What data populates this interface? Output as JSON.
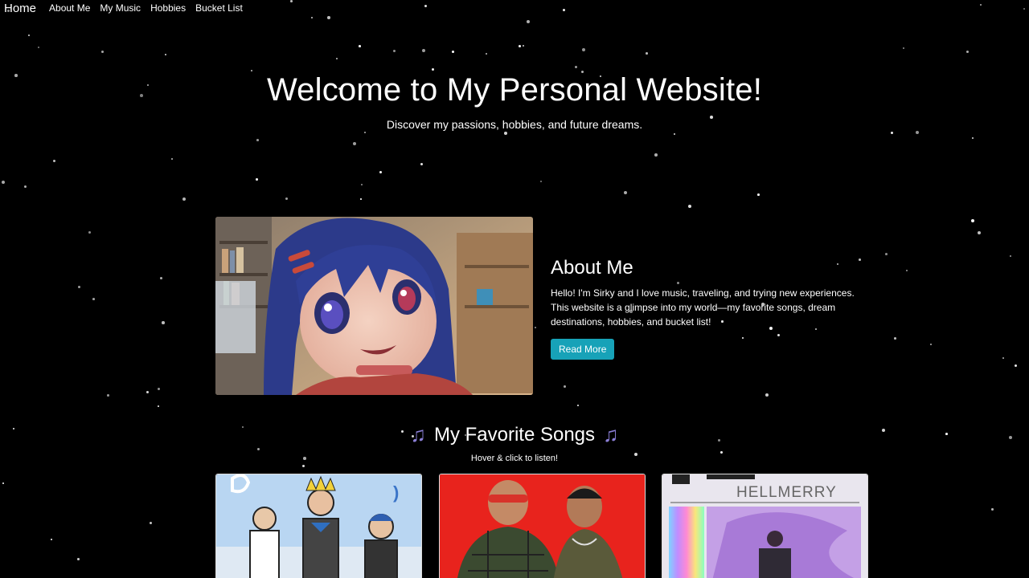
{
  "nav": {
    "brand": "Home",
    "links": [
      "About Me",
      "My Music",
      "Hobbies",
      "Bucket List"
    ]
  },
  "hero": {
    "title": "Welcome to My Personal Website!",
    "subtitle": "Discover my passions, hobbies, and future dreams."
  },
  "about": {
    "title": "About Me",
    "body": "Hello! I'm Sirky and I love music, traveling, and trying new experiences. This website is a glimpse into my world—my favorite songs, dream destinations, hobbies, and bucket list!",
    "button": "Read More"
  },
  "songs": {
    "title": "My Favorite Songs",
    "hint": "Hover & click to listen!",
    "cards": [
      {
        "label": "album-cover-1",
        "art_text": ""
      },
      {
        "label": "album-cover-2",
        "art_text": ""
      },
      {
        "label": "album-cover-3",
        "art_text": "HELLMERRY"
      }
    ]
  },
  "colors": {
    "background": "#000000",
    "button": "#17a2b8",
    "note": "#8b7fd6"
  }
}
